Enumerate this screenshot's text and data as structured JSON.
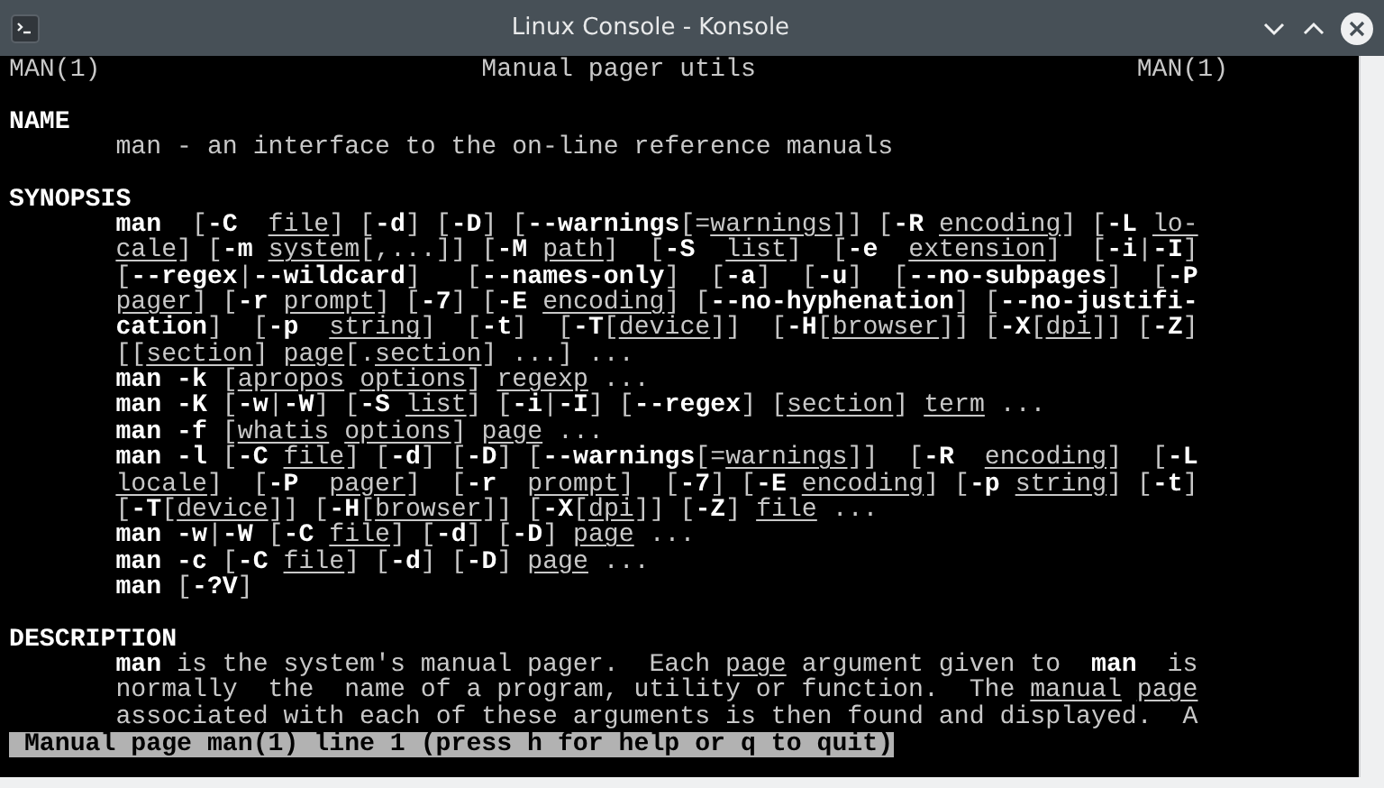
{
  "window": {
    "title": "Linux Console - Konsole"
  },
  "header": {
    "left": "MAN(1)",
    "center": "Manual pager utils",
    "right": "MAN(1)"
  },
  "sections": [
    {
      "title": "NAME",
      "lines": [
        "man - an interface to the on-line reference manuals"
      ]
    },
    {
      "title": "SYNOPSIS",
      "lines": [
        "**man**  [**-C**  *file*] [**-d**] [**-D**] [**--warnings**[=*warnings*]] [**-R** *encoding*] [**-L** *lo-*",
        "*cale*] [**-m** *system*[,...]] [**-M** *path*]  [**-S**  *list*]  [**-e**  *extension*]  [**-i**|**-I**]",
        "[**--regex**|**--wildcard**]   [**--names-only**]  [**-a**]  [**-u**]  [**--no-subpages**]  [**-P**",
        "*pager*] [**-r** *prompt*] [**-7**] [**-E** *encoding*] [**--no-hyphenation**] [**--no-justifi-**",
        "**cation**]  [**-p**  *string*]  [**-t**]  [**-T**[*device*]]  [**-H**[*browser*]] [**-X**[*dpi*]] [**-Z**]",
        "[[*section*] *page*[.*section*] ...] ...",
        "**man -k** [*apropos* *options*] *regexp* ...",
        "**man -K** [**-w**|**-W**] [**-S** *list*] [**-i**|**-I**] [**--regex**] [*section*] *term* ...",
        "**man -f** [*whatis* *options*] *page* ...",
        "**man -l** [**-C** *file*] [**-d**] [**-D**] [**--warnings**[=*warnings*]]  [**-R**  *encoding*]  [**-L**",
        "*locale*]  [**-P**  *pager*]  [**-r**  *prompt*]  [**-7**] [**-E** *encoding*] [**-p** *string*] [**-t**]",
        "[**-T**[*device*]] [**-H**[*browser*]] [**-X**[*dpi*]] [**-Z**] *file* ...",
        "**man -w**|**-W** [**-C** *file*] [**-d**] [**-D**] *page* ...",
        "**man -c** [**-C** *file*] [**-d**] [**-D**] *page* ...",
        "**man** [**-?V**]"
      ]
    },
    {
      "title": "DESCRIPTION",
      "lines": [
        "**man** is the system's manual pager.  Each *page* argument given to  **man**  is",
        "normally  the  name of a program, utility or function.  The *manual* *page*",
        "associated with each of these arguments is then found and displayed.  A"
      ]
    }
  ],
  "status_bar": "Manual page man(1) line 1 (press h for help or q to quit)"
}
